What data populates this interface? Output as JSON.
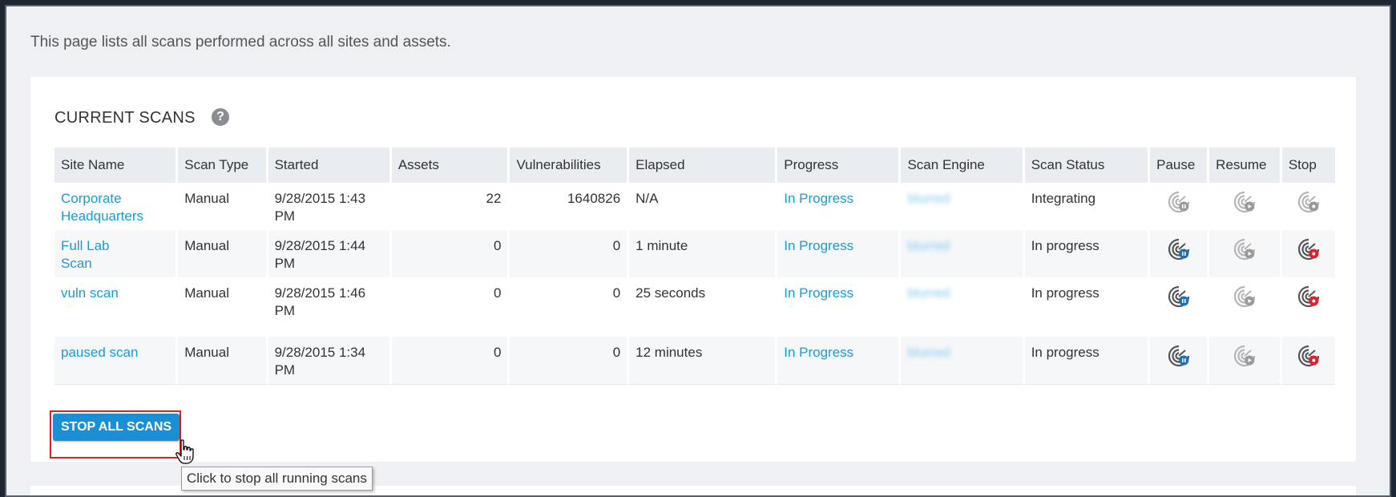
{
  "intro_text": "This page lists all scans performed across all sites and assets.",
  "section": {
    "title": "CURRENT SCANS",
    "help_icon": "question-circle-icon"
  },
  "table": {
    "headers": [
      "Site Name",
      "Scan Type",
      "Started",
      "Assets",
      "Vulnerabilities",
      "Elapsed",
      "Progress",
      "Scan Engine",
      "Scan Status",
      "Pause",
      "Resume",
      "Stop"
    ],
    "rows": [
      {
        "site_name_line1": "Corporate",
        "site_name_line2": "Headquarters",
        "scan_type": "Manual",
        "started_line1": "9/28/2015 1:43",
        "started_line2": "PM",
        "assets": "22",
        "vulnerabilities": "1640826",
        "elapsed": "N/A",
        "progress": "In Progress",
        "scan_engine": "blurred",
        "scan_status": "Integrating",
        "pause_enabled": false,
        "resume_enabled": false,
        "stop_enabled": false
      },
      {
        "site_name_line1": "Full Lab",
        "site_name_line2": "Scan",
        "scan_type": "Manual",
        "started_line1": "9/28/2015 1:44",
        "started_line2": "PM",
        "assets": "0",
        "vulnerabilities": "0",
        "elapsed": "1 minute",
        "progress": "In Progress",
        "scan_engine": "blurred",
        "scan_status": "In progress",
        "pause_enabled": true,
        "resume_enabled": false,
        "stop_enabled": true
      },
      {
        "site_name_line1": "vuln scan",
        "site_name_line2": "",
        "scan_type": "Manual",
        "started_line1": "9/28/2015 1:46",
        "started_line2": "PM",
        "assets": "0",
        "vulnerabilities": "0",
        "elapsed": "25 seconds",
        "progress": "In Progress",
        "scan_engine": "blurred",
        "scan_status": "In progress",
        "pause_enabled": true,
        "resume_enabled": false,
        "stop_enabled": true
      },
      {
        "site_name_line1": "paused scan",
        "site_name_line2": "",
        "scan_type": "Manual",
        "started_line1": "9/28/2015 1:34",
        "started_line2": "PM",
        "assets": "0",
        "vulnerabilities": "0",
        "elapsed": "12 minutes",
        "progress": "In Progress",
        "scan_engine": "blurred",
        "scan_status": "In progress",
        "pause_enabled": true,
        "resume_enabled": false,
        "stop_enabled": true
      }
    ]
  },
  "stop_all_button": {
    "label": "STOP ALL SCANS",
    "tooltip": "Click to stop all running scans"
  },
  "colors": {
    "link": "#1c9ad6",
    "button": "#1a8fd6",
    "pause_badge": "#1f6fb8",
    "stop_badge": "#e0202e",
    "disabled_badge": "#9a9a9a",
    "highlight": "#e02020"
  },
  "icons": {
    "pause": "scan-pause-icon",
    "resume": "scan-resume-icon",
    "stop": "scan-stop-icon",
    "cursor": "hand-pointer-icon"
  }
}
